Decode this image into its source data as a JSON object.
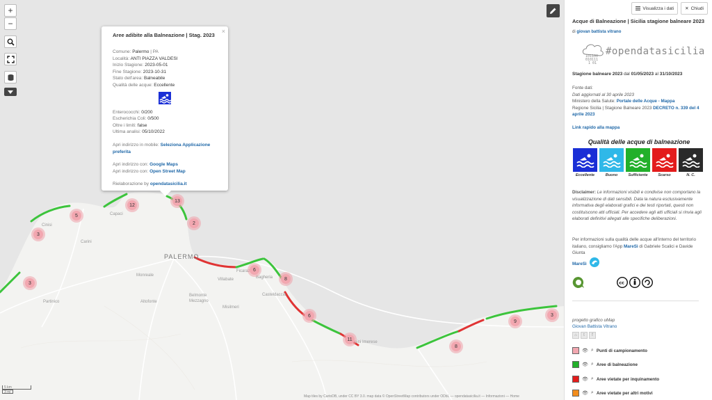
{
  "map": {
    "zoom_in": "+",
    "zoom_out": "−",
    "labels": {
      "palermo": "PALERMO",
      "capaci": "Capaci",
      "cinisi": "Cinisi",
      "carini": "Carini",
      "monreale": "Monreale",
      "altofonte": "Altofonte",
      "partinico": "Partinico",
      "villabate": "Villabate",
      "ficarazzi": "Ficarazzi",
      "bagheria": "Bagheria",
      "belmonte": "Belmonte\nMezzagno",
      "misilmeri": "Misilmeri",
      "casteldaccia": "Casteldaccia",
      "termini": "Termini Imerese"
    },
    "clusters": [
      "12",
      "13",
      "5",
      "2",
      "3",
      "6",
      "8",
      "3",
      "6",
      "11",
      "8",
      "9",
      "3"
    ],
    "scale": {
      "km": "5 km",
      "mi": "3 mi"
    },
    "attribution": "Map tiles by CartoDB, under CC BY 3.0. map data © OpenStreetMap contributors under ODbL — opendatasicilia.it   — Informazioni — Home"
  },
  "popup": {
    "title": "Aree adibite alla Balneazione | Stag. 2023",
    "rows": {
      "comune_label": "Comune:",
      "comune_value": "Palermo",
      "comune_prov": " | PA",
      "localita_label": "Località:",
      "localita_value": "ANTI PIAZZA VALDESI",
      "inizio_label": "Inizio Stagione:",
      "inizio_value": "2023-05-01",
      "fine_label": "Fine Stagione:",
      "fine_value": "2023-10-31",
      "stato_label": "Stato dell'area:",
      "stato_value": "Balneabile",
      "qualita_label": "Qualità delle acque:",
      "qualita_value": "Eccellente",
      "entero_label": "Enterococchi:",
      "entero_value": "0/200",
      "escher_label": "Escherichia Coli:",
      "escher_value": "0/500",
      "oltre_label": "Oltre i limiti:",
      "oltre_value": "false",
      "ultima_label": "Ultima analisi:",
      "ultima_value": " 05/10/2022",
      "mobile_label": "Apri indirizzo in mobile:",
      "mobile_link": "Seleziona Applicazione preferita",
      "gmaps_label": "Apri indirizzo con:",
      "gmaps_link": "Google Maps",
      "osm_label": "Apri indirizzo con:",
      "osm_link": "Open Street Map",
      "riel_label": "Rielaborazione by",
      "riel_link": "opendatasicilia.it"
    },
    "close": "×"
  },
  "sidebar": {
    "btn_data": "Visualizza i dati",
    "btn_close": "Chiudi",
    "title": "Acque di Balneazione | Sicilia stagione balneare 2023",
    "author_prefix": "di ",
    "author": "giovan battista vitrano",
    "logo_text": "#opendatasicilia",
    "season_label": "Stagione balneare 2023",
    "season_from": " dal ",
    "season_start": "01/05/2023",
    "season_to": " al ",
    "season_end": "31/10/2023",
    "fonte_title": "Fonte dati:",
    "fonte_updated": "Dati aggiornati al 30 aprile 2023",
    "fonte_min": "Ministero della Salute: ",
    "fonte_min_link": "Portale delle Acque - Mappa",
    "fonte_reg": "Regione Sicilia | Stagione Balneare 2023 ",
    "fonte_reg_link": "DECRETO n. 339 del 4 aprile 2023",
    "quick_link": "Link rapido alla mappa",
    "quality_title": "Qualità delle acque di balneazione",
    "quality": [
      {
        "label": "Eccellente",
        "color": "#1a2fd6"
      },
      {
        "label": "Buono",
        "color": "#2fb8e8"
      },
      {
        "label": "Sufficiente",
        "color": "#22b02a"
      },
      {
        "label": "Scarso",
        "color": "#e31c1c"
      },
      {
        "label": "N. C.",
        "color": "#2a2a2a"
      }
    ],
    "disclaimer_label": "Disclaimer:",
    "disclaimer": " Le informazioni visibili e condivise non comportano la visualizzazione di dati sensibili. Data la natura esclusivamente informativa degli elaborati grafici e dei testi riportati, questi non costituiscono atti ufficiali. Per accedere agli atti ufficiali si rinvia agli elaborati definitivi allegati alle specifiche deliberazioni.",
    "maresi_text": "Per informazioni sulla qualità delle acque all'interno del territorio italiano, consigliamo l'App ",
    "maresi_link": "MareSì",
    "maresi_suffix": " di Gabriele Scalici e Davide Giunta",
    "maresi_logo": "MareSì",
    "project": "progetto grafico uMap",
    "project_author": "Giovan Battista Vitrano",
    "legend": [
      {
        "label": "Punti di campionamento",
        "color": "#f2a7b0"
      },
      {
        "label": "Aree di balneazione",
        "color": "#22b02a"
      },
      {
        "label": "Aree vietate per inquinamento",
        "color": "#e31c1c"
      },
      {
        "label": "Aree vietate per altri motivi",
        "color": "#f28c1c"
      }
    ]
  }
}
